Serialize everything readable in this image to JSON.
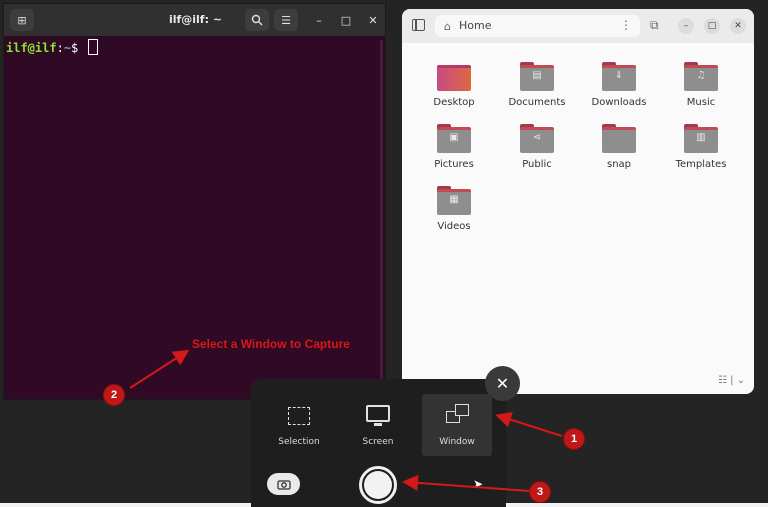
{
  "terminal": {
    "title": "ilf@ilf: ~",
    "prompt_user": "ilf@ilf",
    "prompt_sep": ":",
    "prompt_path": "~",
    "prompt_symbol": "$"
  },
  "files": {
    "location": "Home",
    "items": [
      {
        "label": "Desktop"
      },
      {
        "label": "Documents"
      },
      {
        "label": "Downloads"
      },
      {
        "label": "Music"
      },
      {
        "label": "Pictures"
      },
      {
        "label": "Public"
      },
      {
        "label": "snap"
      },
      {
        "label": "Templates"
      },
      {
        "label": "Videos"
      }
    ]
  },
  "screenshot_panel": {
    "modes": [
      {
        "label": "Selection",
        "active": false
      },
      {
        "label": "Screen",
        "active": false
      },
      {
        "label": "Window",
        "active": true
      }
    ]
  },
  "annotation": {
    "text": "Select a Window to Capture",
    "badges": [
      "1",
      "2",
      "3"
    ],
    "color": "#d71818"
  },
  "theme": {
    "terminal_bg": "#300a24",
    "panel_bg": "#1e1e1e",
    "folder_accent": "#c04a55"
  }
}
